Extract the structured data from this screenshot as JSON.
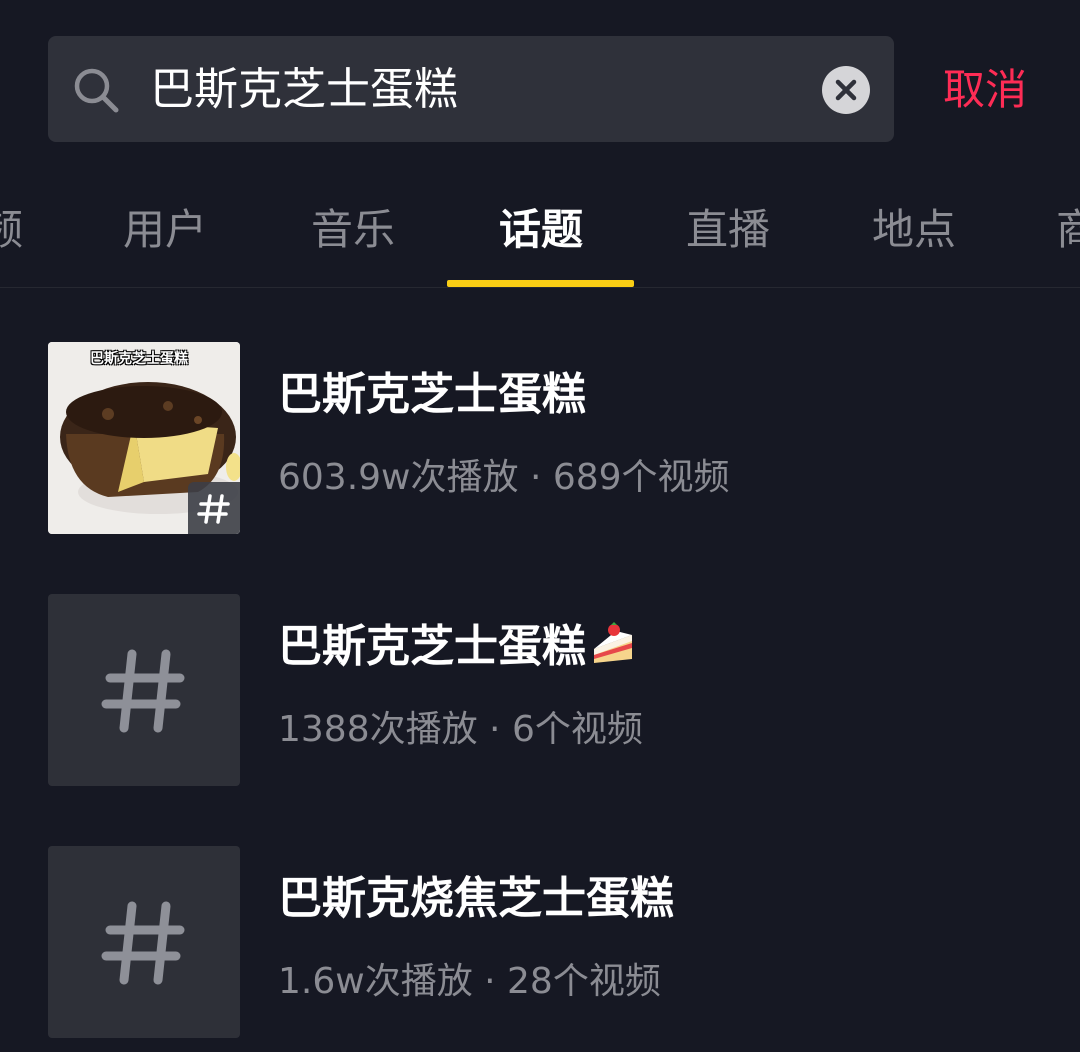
{
  "search": {
    "query": "巴斯克芝士蛋糕",
    "cancel_label": "取消"
  },
  "tabs": [
    {
      "label": "频",
      "active": false
    },
    {
      "label": "用户",
      "active": false
    },
    {
      "label": "音乐",
      "active": false
    },
    {
      "label": "话题",
      "active": true
    },
    {
      "label": "直播",
      "active": false
    },
    {
      "label": "地点",
      "active": false
    },
    {
      "label": "商",
      "active": false
    }
  ],
  "results": [
    {
      "title": "巴斯克芝士蛋糕",
      "meta": "603.9w次播放 · 689个视频",
      "thumb_caption": "巴斯克芝士蛋糕",
      "thumb_type": "photo"
    },
    {
      "title": "巴斯克芝士蛋糕",
      "meta": "1388次播放 · 6个视频",
      "thumb_type": "hashtag",
      "title_emoji": "cake-icon"
    },
    {
      "title": "巴斯克烧焦芝士蛋糕",
      "meta": "1.6w次播放 · 28个视频",
      "thumb_type": "hashtag"
    }
  ],
  "colors": {
    "background": "#161823",
    "search_field": "#2f313a",
    "cancel": "#fe2c55",
    "tab_indicator": "#face15",
    "muted_text": "#8b8c93"
  }
}
